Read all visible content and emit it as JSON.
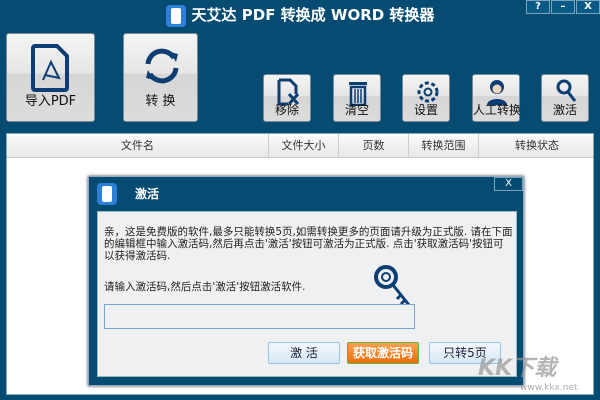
{
  "window": {
    "title": "天艾达 PDF 转换成 WORD 转换器",
    "help": "?",
    "minimize": "–",
    "close": "X"
  },
  "toolbar": {
    "import": "导入PDF",
    "convert": "转 换",
    "remove": "移除",
    "clear": "清空",
    "settings": "设置",
    "manual": "人工转换",
    "activate": "激活"
  },
  "table": {
    "columns": [
      "文件名",
      "文件大小",
      "页数",
      "转换范围",
      "转换状态"
    ]
  },
  "dialog": {
    "title": "激活",
    "close": "X",
    "message": "亲，这是免费版的软件,最多只能转换5页,如需转换更多的页面请升级为正式版. 请在下面的编辑框中输入激活码,然后再点击'激活'按钮可激活为正式版. 点击'获取激活码'按钮可以获得激活码.",
    "prompt": "请输入激活码,然后点击'激活'按钮激活软件.",
    "code_value": "",
    "activate_btn": "激 活",
    "get_code_btn": "获取激活码",
    "only5_btn": "只转5页"
  },
  "watermark": {
    "brand": "KK下载",
    "url": "www.kkx.net"
  }
}
